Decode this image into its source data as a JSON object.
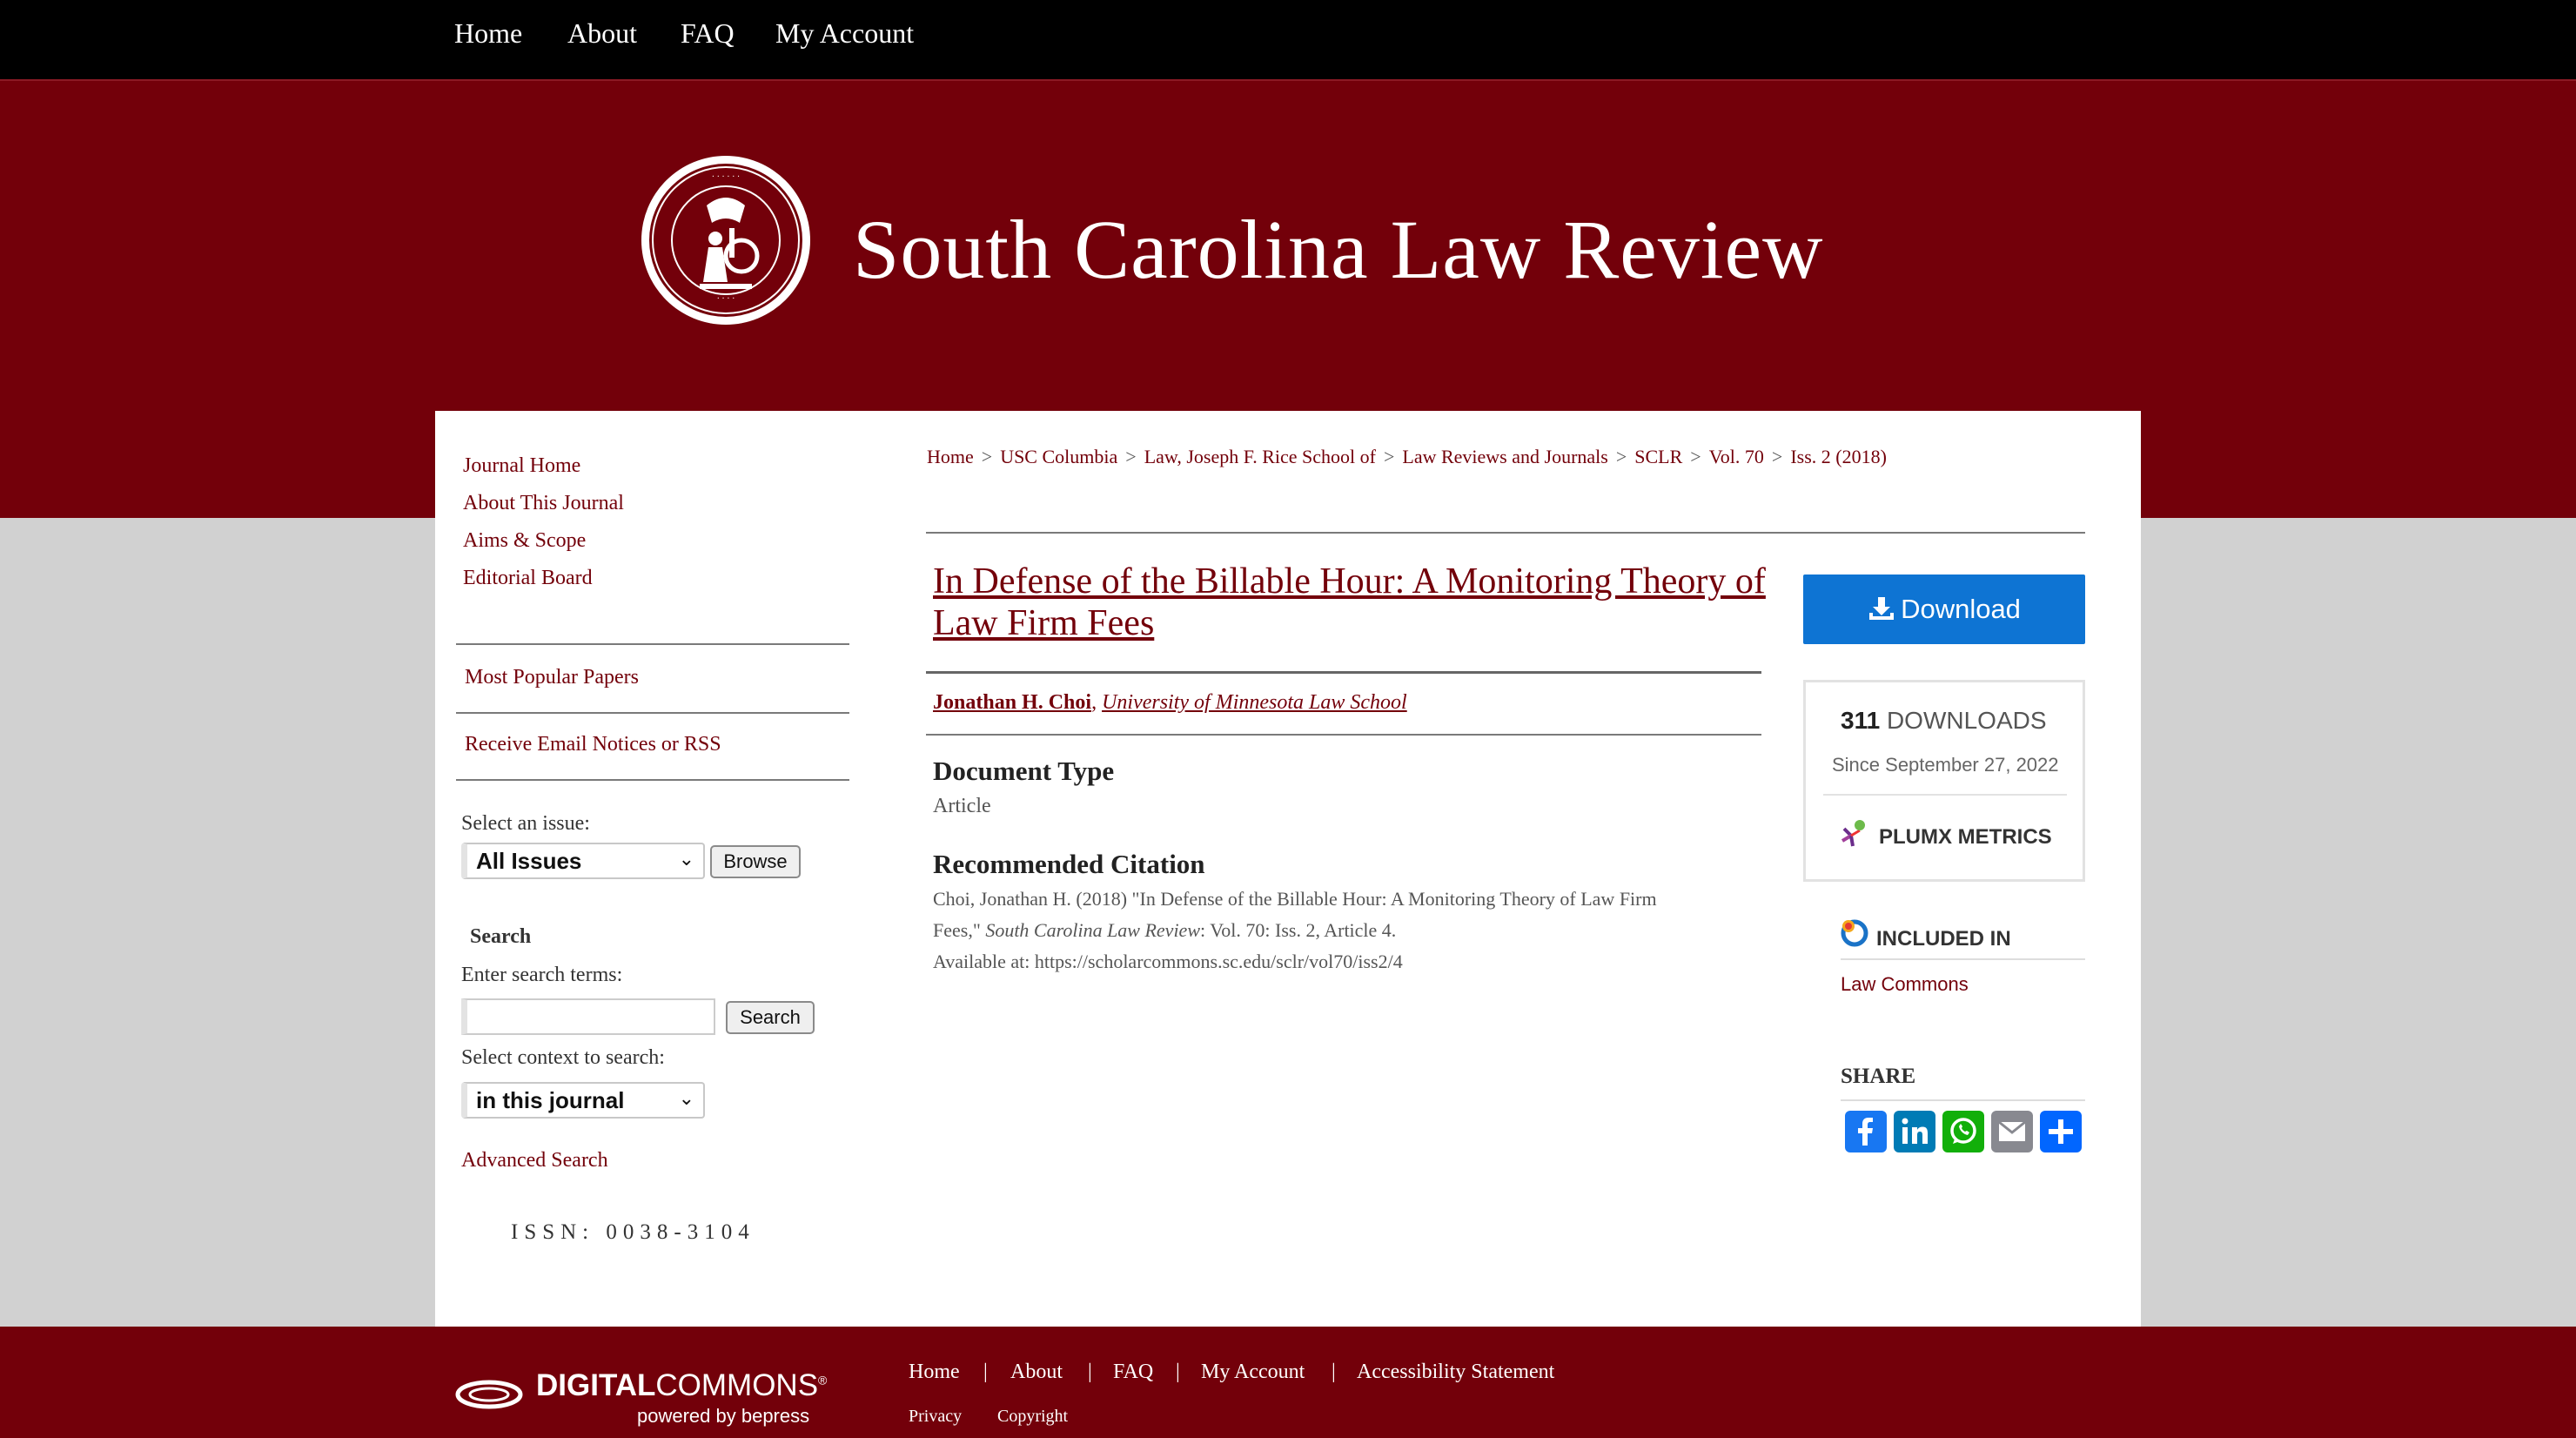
{
  "topnav": {
    "home": "Home",
    "about": "About",
    "faq": "FAQ",
    "my_account": "My Account"
  },
  "banner": {
    "title": "South Carolina Law Review"
  },
  "sidebar": {
    "journal_home": "Journal Home",
    "about_journal": "About This Journal",
    "aims_scope": "Aims & Scope",
    "editorial_board": "Editorial Board",
    "most_popular": "Most Popular Papers",
    "email_notices": "Receive Email Notices or RSS",
    "select_issue_label": "Select an issue:",
    "issue_selected": "All Issues",
    "browse_button": "Browse",
    "search_heading": "Search",
    "search_terms_label": "Enter search terms:",
    "search_value": "",
    "search_button": "Search",
    "context_label": "Select context to search:",
    "context_selected": "in this journal",
    "advanced_search": "Advanced Search",
    "issn": "ISSN: 0038-3104"
  },
  "breadcrumb": [
    "Home",
    "USC Columbia",
    "Law, Joseph F. Rice School of",
    "Law Reviews and Journals",
    "SCLR",
    "Vol. 70",
    "Iss. 2 (2018)"
  ],
  "breadcrumb_separator": ">",
  "article": {
    "title": "In Defense of the Billable Hour: A Monitoring Theory of Law Firm Fees",
    "author": "Jonathan H. Choi",
    "author_separator": ",",
    "affiliation": "University of Minnesota Law School",
    "document_type_heading": "Document Type",
    "document_type": "Article",
    "citation_heading": "Recommended Citation",
    "citation_line1": "Choi, Jonathan H. (2018) \"In Defense of the Billable Hour: A Monitoring Theory of Law Firm",
    "citation_line2_prefix": "Fees,\"",
    "citation_journal": "South Carolina Law Review",
    "citation_line2_suffix": ": Vol. 70: Iss. 2, Article 4.",
    "citation_line3": "Available at: https://scholarcommons.sc.edu/sclr/vol70/iss2/4"
  },
  "right": {
    "download_button": "Download",
    "downloads_count": "311",
    "downloads_label": "DOWNLOADS",
    "since": "Since September 27, 2022",
    "plumx": "PLUMX METRICS",
    "included_in_heading": "INCLUDED IN",
    "included_in_link": "Law Commons",
    "share_heading": "SHARE"
  },
  "share_icons": [
    {
      "name": "facebook-icon",
      "color": "#1877f2"
    },
    {
      "name": "linkedin-icon",
      "color": "#007bb5"
    },
    {
      "name": "whatsapp-icon",
      "color": "#12af0a"
    },
    {
      "name": "email-icon",
      "color": "#888990"
    },
    {
      "name": "share-icon",
      "color": "#0166ff"
    }
  ],
  "footer": {
    "logo_text_digital": "DIGITAL",
    "logo_text_commons": "COMMONS",
    "logo_subtext": "powered by bepress",
    "home": "Home",
    "about": "About",
    "faq": "FAQ",
    "my_account": "My Account",
    "accessibility": "Accessibility Statement",
    "separator": "|",
    "privacy": "Privacy",
    "copyright": "Copyright"
  },
  "colors": {
    "brand": "#73000a",
    "download": "#0e74d3",
    "nav_bg": "#000000",
    "page_bg": "#d1d1d1"
  }
}
